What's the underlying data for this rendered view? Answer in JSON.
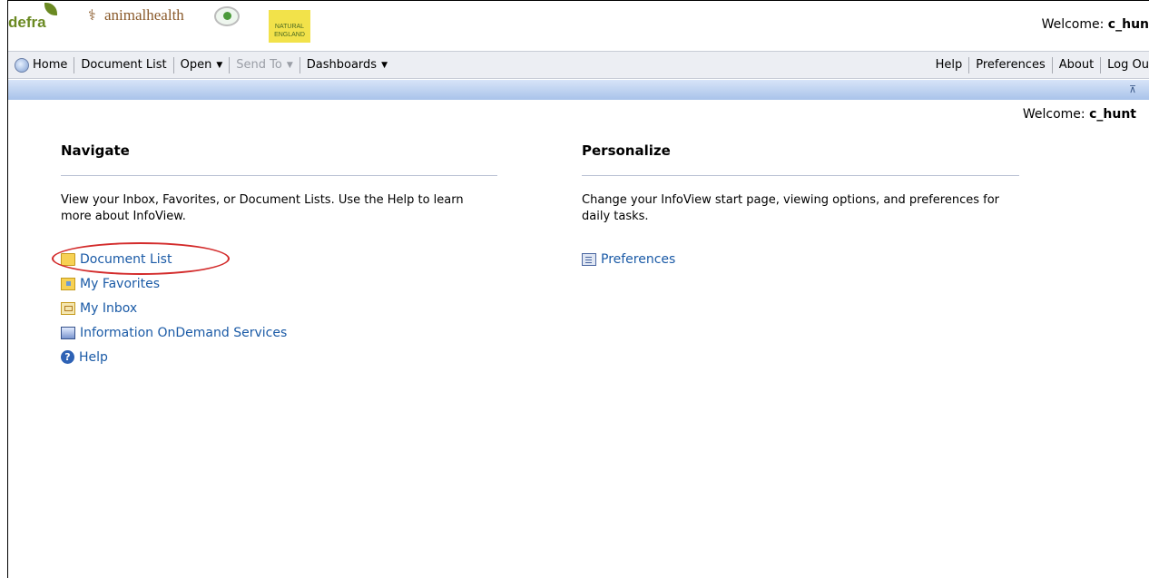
{
  "banner": {
    "logo_defra": "defra",
    "logo_animalhealth": "animalhealth",
    "logo_naturalengland": "NATURAL ENGLAND",
    "welcome_label": "Welcome:",
    "username": "c_hun"
  },
  "toolbar": {
    "left": [
      {
        "label": "Home",
        "icon": "home-icon"
      },
      {
        "label": "Document List"
      },
      {
        "label": "Open",
        "dropdown": true
      },
      {
        "label": "Send To",
        "dropdown": true,
        "disabled": true
      },
      {
        "label": "Dashboards",
        "dropdown": true
      }
    ],
    "right": [
      {
        "label": "Help"
      },
      {
        "label": "Preferences"
      },
      {
        "label": "About"
      },
      {
        "label": "Log Ou"
      }
    ]
  },
  "subheader": {
    "welcome_label": "Welcome:",
    "username": "c_hunt"
  },
  "navigate": {
    "title": "Navigate",
    "description": "View your Inbox, Favorites, or Document Lists. Use the Help to learn more about InfoView.",
    "links": [
      {
        "label": "Document List",
        "icon": "folder-icon"
      },
      {
        "label": "My Favorites",
        "icon": "favorites-folder-icon"
      },
      {
        "label": "My Inbox",
        "icon": "inbox-icon"
      },
      {
        "label": "Information OnDemand Services",
        "icon": "ondemand-services-icon"
      },
      {
        "label": "Help",
        "icon": "help-icon"
      }
    ]
  },
  "personalize": {
    "title": "Personalize",
    "description": "Change your InfoView start page, viewing options, and preferences for daily tasks.",
    "links": [
      {
        "label": "Preferences",
        "icon": "preferences-icon"
      }
    ]
  },
  "colors": {
    "link": "#1a5aa6",
    "highlight_circle": "#d32b2b",
    "toolbar_bg": "#eceef3",
    "band": "#a9c3ea"
  }
}
